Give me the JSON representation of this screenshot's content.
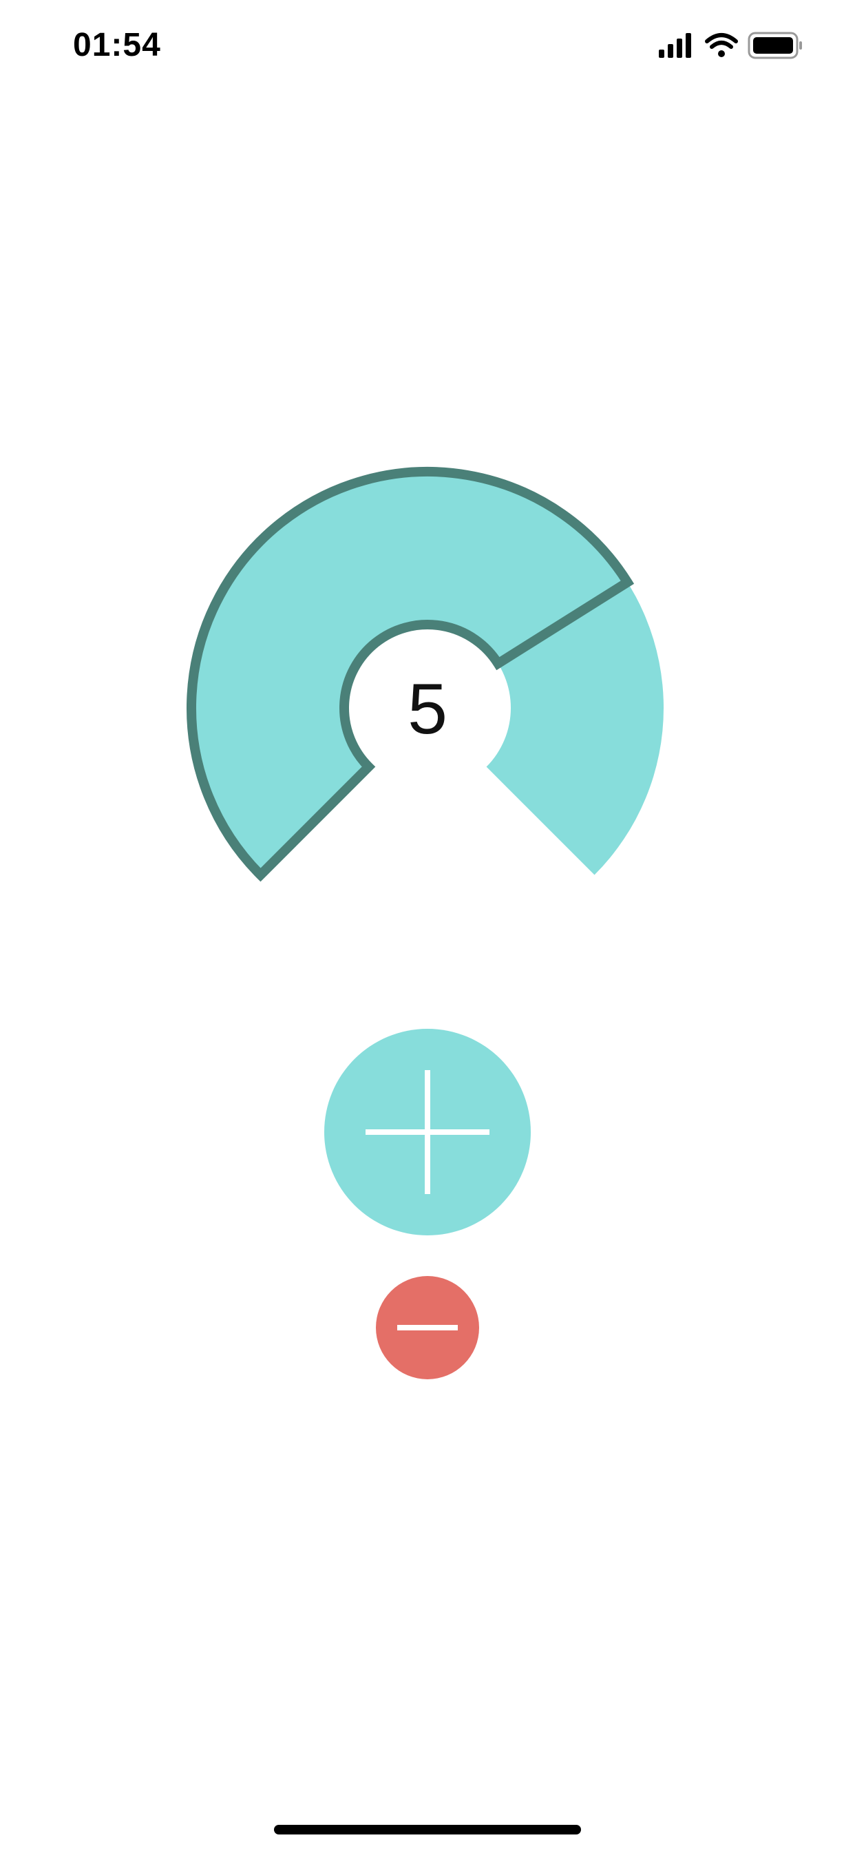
{
  "status_bar": {
    "time": "01:54",
    "icons": [
      "signal-icon",
      "wifi-icon",
      "battery-icon"
    ]
  },
  "gauge": {
    "value": "5",
    "level": 5,
    "max": 7,
    "colors": {
      "fill": "#87dddb",
      "outline": "#4a8078"
    }
  },
  "controls": {
    "increment_icon": "plus-icon",
    "decrement_icon": "minus-icon",
    "increment_color": "#87dddb",
    "decrement_color": "#e46f67"
  }
}
